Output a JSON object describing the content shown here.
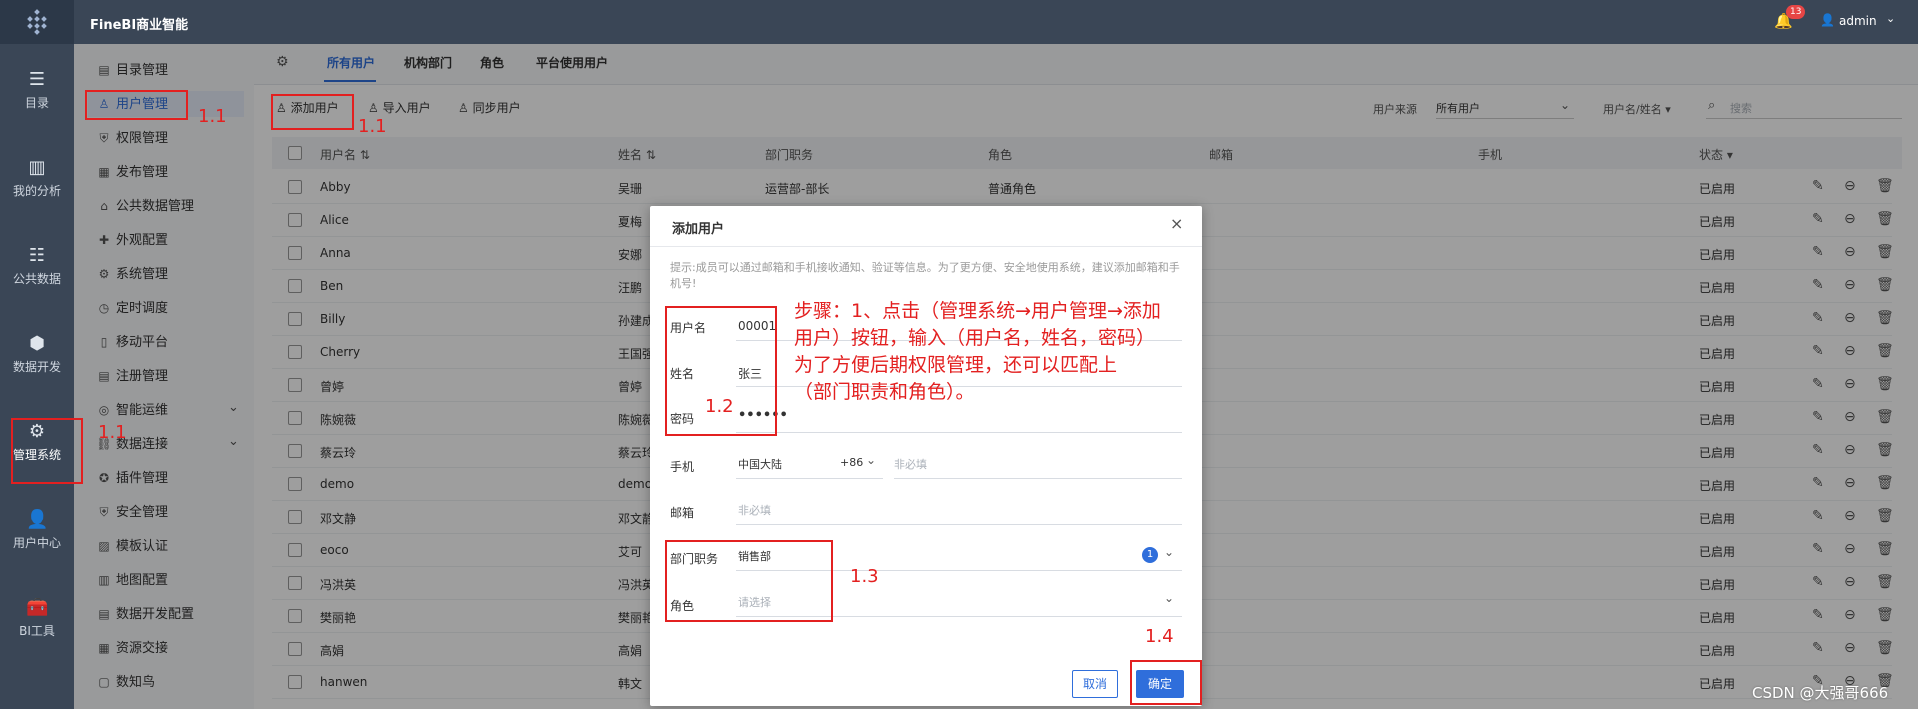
{
  "app": {
    "title": "FineBI商业智能",
    "notif_count": "13",
    "user": "admin"
  },
  "rail": [
    {
      "label": "目录",
      "icon": "catalog-icon"
    },
    {
      "label": "我的分析",
      "icon": "analysis-icon"
    },
    {
      "label": "公共数据",
      "icon": "public-data-icon"
    },
    {
      "label": "数据开发",
      "icon": "data-dev-icon"
    },
    {
      "label": "管理系统",
      "icon": "manage-system-icon"
    },
    {
      "label": "用户中心",
      "icon": "user-center-icon"
    },
    {
      "label": "BI工具",
      "icon": "bi-tools-icon"
    }
  ],
  "nav": [
    "目录管理",
    "用户管理",
    "权限管理",
    "发布管理",
    "公共数据管理",
    "外观配置",
    "系统管理",
    "定时调度",
    "移动平台",
    "注册管理",
    "智能运维",
    "数据连接",
    "插件管理",
    "安全管理",
    "模板认证",
    "地图配置",
    "数据开发配置",
    "资源交接",
    "数知鸟"
  ],
  "tabs": [
    "所有用户",
    "机构部门",
    "角色",
    "平台使用用户"
  ],
  "toolbar": {
    "add": "添加用户",
    "import": "导入用户",
    "sync": "同步用户",
    "source_label": "用户来源",
    "source_value": "所有用户",
    "filter_label": "用户名/姓名",
    "search_placeholder": "搜索"
  },
  "columns": [
    "用户名",
    "姓名",
    "部门职务",
    "角色",
    "邮箱",
    "手机",
    "状态"
  ],
  "rows": [
    {
      "username": "Abby",
      "name": "吴珊",
      "dept": "运营部-部长",
      "role": "普通角色",
      "status": "已启用"
    },
    {
      "username": "Alice",
      "name": "夏梅",
      "dept": "",
      "role": "",
      "status": "已启用"
    },
    {
      "username": "Anna",
      "name": "安娜",
      "dept": "",
      "role": "",
      "status": "已启用"
    },
    {
      "username": "Ben",
      "name": "汪鹏",
      "dept": "",
      "role": "",
      "status": "已启用"
    },
    {
      "username": "Billy",
      "name": "孙建成",
      "dept": "",
      "role": "",
      "status": "已启用"
    },
    {
      "username": "Cherry",
      "name": "王国强",
      "dept": "",
      "role": "",
      "status": "已启用"
    },
    {
      "username": "曾婷",
      "name": "曾婷",
      "dept": "",
      "role": "",
      "status": "已启用"
    },
    {
      "username": "陈婉薇",
      "name": "陈婉薇",
      "dept": "",
      "role": "",
      "status": "已启用"
    },
    {
      "username": "蔡云玲",
      "name": "蔡云玲",
      "dept": "",
      "role": "",
      "status": "已启用"
    },
    {
      "username": "demo",
      "name": "demo",
      "dept": "",
      "role": "",
      "status": "已启用"
    },
    {
      "username": "邓文静",
      "name": "邓文静",
      "dept": "",
      "role": "",
      "status": "已启用"
    },
    {
      "username": "eoco",
      "name": "艾可",
      "dept": "",
      "role": "",
      "status": "已启用"
    },
    {
      "username": "冯洪英",
      "name": "冯洪英",
      "dept": "",
      "role": "",
      "status": "已启用"
    },
    {
      "username": "樊丽艳",
      "name": "樊丽艳",
      "dept": "",
      "role": "",
      "status": "已启用"
    },
    {
      "username": "高娟",
      "name": "高娟",
      "dept": "",
      "role": "",
      "status": "已启用"
    },
    {
      "username": "hanwen",
      "name": "韩文",
      "dept": "",
      "role": "",
      "status": "已启用"
    }
  ],
  "dialog": {
    "title": "添加用户",
    "hint": "提示:成员可以通过邮箱和手机接收通知、验证等信息。为了更方便、安全地使用系统，建议添加邮箱和手机号!",
    "username_label": "用户名",
    "username_value": "00001",
    "name_label": "姓名",
    "name_value": "张三",
    "password_label": "密码",
    "password_value": "••••••",
    "phone_label": "手机",
    "phone_region": "中国大陆",
    "phone_code": "+86",
    "phone_placeholder": "非必填",
    "email_label": "邮箱",
    "email_placeholder": "非必填",
    "dept_label": "部门职务",
    "dept_value": "销售部",
    "dept_count": "1",
    "role_label": "角色",
    "role_placeholder": "请选择",
    "cancel": "取消",
    "confirm": "确定"
  },
  "annotations": {
    "a11": "1.1",
    "a12": "1.2",
    "a13": "1.3",
    "a14": "1.4",
    "step_line1": "步骤：1、点击（管理系统→用户管理→添加",
    "step_line2": "用户）按钮，输入（用户名，姓名，密码）",
    "step_line3": "为了方便后期权限管理，还可以匹配上",
    "step_line4": "（部门职责和角色）。"
  },
  "watermark": "CSDN @大强哥666"
}
